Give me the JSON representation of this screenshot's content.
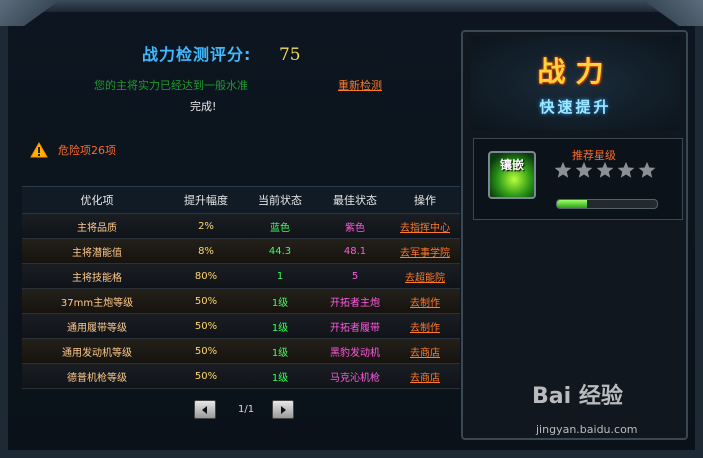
{
  "score": {
    "label": "战力检测评分:",
    "value": "75"
  },
  "level_text": "您的主将实力已经达到一般水准",
  "recheck_label": "重新检测",
  "done_label": "完成!",
  "danger_label": "危险项26项",
  "table": {
    "headers": [
      "优化项",
      "提升幅度",
      "当前状态",
      "最佳状态",
      "操作"
    ],
    "rows": [
      {
        "item": "主将品质",
        "boost": "2%",
        "current": "蓝色",
        "best": "紫色",
        "action": "去指挥中心",
        "current_color": "#3aff5a",
        "best_color": "#ff5ae0"
      },
      {
        "item": "主将潜能值",
        "boost": "8%",
        "current": "44.3",
        "best": "48.1",
        "action": "去军事学院",
        "current_color": "#3aff5a",
        "best_color": "#ff5ae0"
      },
      {
        "item": "主将技能格",
        "boost": "80%",
        "current": "1",
        "best": "5",
        "action": "去超能院",
        "current_color": "#3aff5a",
        "best_color": "#ff5ae0"
      },
      {
        "item": "37mm主炮等级",
        "boost": "50%",
        "current": "1级",
        "best": "开拓者主炮",
        "action": "去制作",
        "current_color": "#3aff5a",
        "best_color": "#ff5ae0"
      },
      {
        "item": "通用履带等级",
        "boost": "50%",
        "current": "1级",
        "best": "开拓者履带",
        "action": "去制作",
        "current_color": "#3aff5a",
        "best_color": "#ff5ae0"
      },
      {
        "item": "通用发动机等级",
        "boost": "50%",
        "current": "1级",
        "best": "黑豹发动机",
        "action": "去商店",
        "current_color": "#3aff5a",
        "best_color": "#ff5ae0"
      },
      {
        "item": "德普机枪等级",
        "boost": "50%",
        "current": "1级",
        "best": "马克沁机枪",
        "action": "去商店",
        "current_color": "#3aff5a",
        "best_color": "#ff5ae0"
      }
    ]
  },
  "pager": {
    "text": "1/1"
  },
  "power_panel": {
    "title": "战力",
    "subtitle": "快速提升"
  },
  "recommend": {
    "icon_label": "镶嵌",
    "label": "推荐星级",
    "stars_filled": 0,
    "stars_total": 5,
    "progress": 0.3
  },
  "watermark": {
    "logo": "Bai  经验",
    "url": "jingyan.baidu.com"
  }
}
